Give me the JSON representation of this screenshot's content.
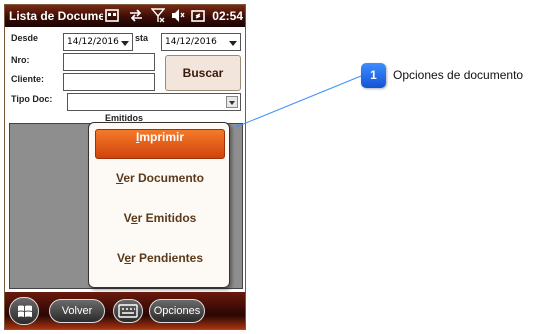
{
  "titlebar": {
    "app_title": "Lista de Docume",
    "time": "02:54",
    "icons": [
      "window-icon",
      "sync-arrows-icon",
      "no-signal-icon",
      "volume-mute-icon",
      "battery-charging-icon"
    ]
  },
  "form": {
    "desde_label": "Desde",
    "desde_value": "14/12/2016",
    "hasta_label": "sta",
    "hasta_value": "14/12/2016",
    "nro_label": "Nro:",
    "nro_value": "",
    "cliente_label": "Cliente:",
    "cliente_value": "",
    "tipo_doc_label": "Tipo Doc:",
    "tipo_doc_value": "",
    "buscar_label": "Buscar",
    "list_caption": "Emitidos"
  },
  "context_menu": {
    "items": [
      {
        "hotkey": "I",
        "rest": "mprimir",
        "selected": true
      },
      {
        "hotkey": "V",
        "rest": "er Documento",
        "selected": false
      },
      {
        "prefix": "V",
        "hotkey": "e",
        "rest": "r Emitidos",
        "selected": false
      },
      {
        "prefix": "V",
        "hotkey": "e",
        "rest": "r Pendientes",
        "selected": false
      }
    ]
  },
  "bottombar": {
    "volver_label": "Volver",
    "opciones_label": "Opciones",
    "icons": [
      "windows-start-icon",
      "keyboard-icon"
    ]
  },
  "callout": {
    "number": "1",
    "text": "Opciones de documento",
    "color": "#2f7bef"
  },
  "colors": {
    "accent": "#e85a14",
    "titlebar": "#3a0c06"
  }
}
